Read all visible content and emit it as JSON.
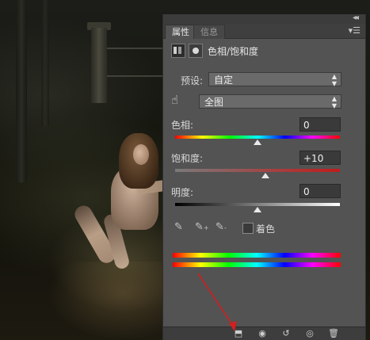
{
  "panel": {
    "tabs": [
      {
        "label": "属性",
        "active": true
      },
      {
        "label": "信息",
        "active": false
      }
    ],
    "title": "色相/饱和度",
    "preset": {
      "label": "预设:",
      "value": "自定"
    },
    "range": {
      "value": "全图"
    },
    "hue": {
      "label": "色相:",
      "value": "0",
      "position": 0.5
    },
    "saturation": {
      "label": "饱和度:",
      "value": "+10",
      "position": 0.55
    },
    "lightness": {
      "label": "明度:",
      "value": "0",
      "position": 0.5
    },
    "colorize": {
      "label": "着色",
      "checked": false
    }
  },
  "icons": {
    "collapse": "double-chevron-left-icon",
    "menu": "panel-menu-icon",
    "hand": "targeted-adjustment-hand-icon",
    "eyedroppers": [
      "eyedropper-icon",
      "eyedropper-plus-icon",
      "eyedropper-minus-icon"
    ],
    "footer": [
      "clip-to-layer-icon",
      "view-previous-state-icon",
      "reset-icon",
      "visibility-eye-icon",
      "trash-icon"
    ]
  },
  "colors": {
    "panel_bg": "#535353",
    "annotation_arrow": "#d21f1f"
  }
}
